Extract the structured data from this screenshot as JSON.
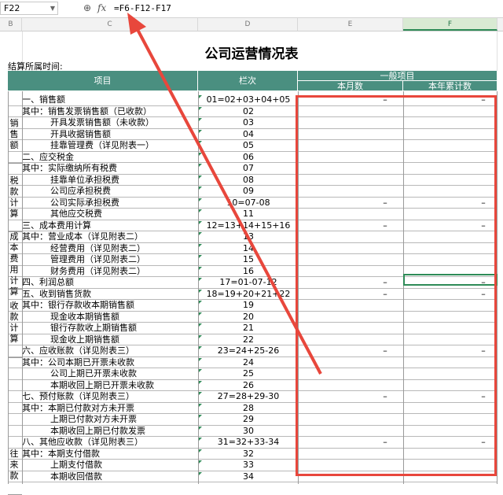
{
  "formula_bar": {
    "cell_ref": "F22",
    "formula": "=F6-F12-F17",
    "fx_label": "fx"
  },
  "columns": [
    "B",
    "C",
    "D",
    "E",
    "F"
  ],
  "sheet": {
    "title": "公司运营情况表",
    "period_label": "结算所属时间:",
    "headers": {
      "item": "项目",
      "line": "栏次",
      "general": "一般项目",
      "month": "本月数",
      "year": "本年累计数"
    }
  },
  "groups": [
    "销售额",
    "税款计算",
    "成本费用计算",
    "收款计算",
    "往来款"
  ],
  "rows": [
    {
      "item": "一、销售额",
      "line": "01=02+03+04+05",
      "dash": true
    },
    {
      "item": "其中：销售发票销售额（已收款）",
      "line": "02",
      "dash": false
    },
    {
      "item": "开具发票销售额（未收款）",
      "line": "03",
      "dash": false
    },
    {
      "item": "开具收据销售额",
      "line": "04",
      "dash": false
    },
    {
      "item": "挂靠管理费（详见附表一）",
      "line": "05",
      "dash": false
    },
    {
      "item": "二、应交税金",
      "line": "06",
      "dash": false
    },
    {
      "item": "其中：实际缴纳所有税费",
      "line": "07",
      "dash": false
    },
    {
      "item": "挂靠单位承担税费",
      "line": "08",
      "dash": false
    },
    {
      "item": "公司应承担税费",
      "line": "09",
      "dash": false
    },
    {
      "item": "公司实际承担税费",
      "line": "10=07-08",
      "dash": true
    },
    {
      "item": "其他应交税费",
      "line": "11",
      "dash": false
    },
    {
      "item": "三、成本费用计算",
      "line": "12=13+14+15+16",
      "dash": true
    },
    {
      "item": "其中：营业成本（详见附表二）",
      "line": "13",
      "dash": false
    },
    {
      "item": "经营费用（详见附表二）",
      "line": "14",
      "dash": false
    },
    {
      "item": "管理费用（详见附表二）",
      "line": "15",
      "dash": false
    },
    {
      "item": "财务费用（详见附表二）",
      "line": "16",
      "dash": false
    },
    {
      "item": "四、利润总额",
      "line": "17=01-07-12",
      "dash": true
    },
    {
      "item": "五、收到销售货款",
      "line": "18=19+20+21+22",
      "dash": true
    },
    {
      "item": "其中：银行存款收本期销售额",
      "line": "19",
      "dash": false
    },
    {
      "item": "现金收本期销售额",
      "line": "20",
      "dash": false
    },
    {
      "item": "银行存款收上期销售额",
      "line": "21",
      "dash": false
    },
    {
      "item": "现金收上期销售额",
      "line": "22",
      "dash": false
    },
    {
      "item": "六、应收账款（详见附表三）",
      "line": "23=24+25-26",
      "dash": true
    },
    {
      "item": "其中：公司本期已开票未收款",
      "line": "24",
      "dash": false
    },
    {
      "item": "公司上期已开票未收款",
      "line": "25",
      "dash": false
    },
    {
      "item": "本期收回上期已开票未收款",
      "line": "26",
      "dash": false
    },
    {
      "item": "七、预付账款（详见附表三）",
      "line": "27=28+29-30",
      "dash": true
    },
    {
      "item": "其中：本期已付款对方未开票",
      "line": "28",
      "dash": false
    },
    {
      "item": "上期已付款对方未开票",
      "line": "29",
      "dash": false
    },
    {
      "item": "本期收回上期已付款发票",
      "line": "30",
      "dash": false
    },
    {
      "item": "八、其他应收款（详见附表三）",
      "line": "31=32+33-34",
      "dash": true
    },
    {
      "item": "其中：本期支付借款",
      "line": "32",
      "dash": false
    },
    {
      "item": "上期支付借款",
      "line": "33",
      "dash": false
    },
    {
      "item": "本期收回借款",
      "line": "34",
      "dash": false
    }
  ],
  "dash_symbol": "–",
  "colors": {
    "header_bg": "#4a8f80",
    "highlight": "#e8473c",
    "selection": "#2e8b57"
  }
}
